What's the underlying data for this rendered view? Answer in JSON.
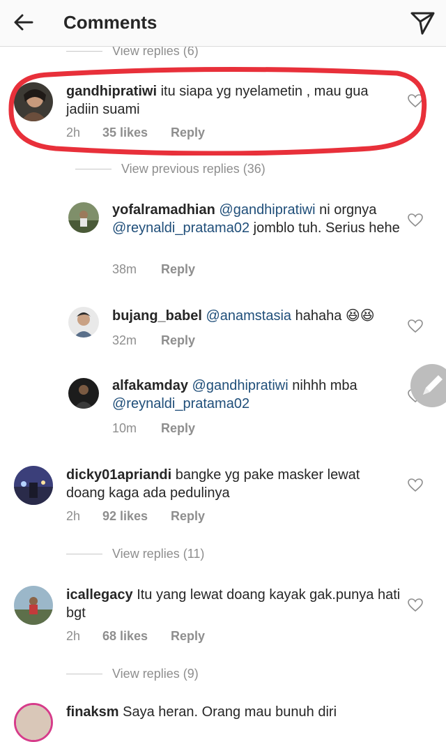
{
  "header": {
    "title": "Comments"
  },
  "top_view_replies": "View replies (6)",
  "comments": [
    {
      "username": "gandhipratiwi",
      "text": "itu siapa yg nyelametin , mau gua jadiin suami",
      "time": "2h",
      "likes": "35 likes",
      "reply": "Reply"
    },
    {
      "view_previous": "View previous replies (36)"
    },
    {
      "username": "yofalramadhian",
      "mention1": "@gandhipratiwi",
      "text1": "ni orgnya",
      "mention2": "@reynaldi_pratama02",
      "text2": "jomblo tuh. Serius hehe",
      "time": "38m",
      "reply": "Reply"
    },
    {
      "username": "bujang_babel",
      "mention1": "@anamstasia",
      "text1": "hahaha 😆😆",
      "time": "32m",
      "reply": "Reply"
    },
    {
      "username": "alfakamday",
      "mention1": "@gandhipratiwi",
      "text1": "nihhh mba",
      "mention2": "@reynaldi_pratama02",
      "time": "10m",
      "reply": "Reply"
    },
    {
      "username": "dicky01apriandi",
      "text": "bangke yg pake masker lewat doang kaga ada pedulinya",
      "time": "2h",
      "likes": "92 likes",
      "reply": "Reply",
      "view_replies": "View replies (11)"
    },
    {
      "username": "icallegacy",
      "text": "Itu yang lewat doang kayak gak.punya hati bgt",
      "time": "2h",
      "likes": "68 likes",
      "reply": "Reply",
      "view_replies": "View replies (9)"
    },
    {
      "username": "finaksm",
      "text": "Saya heran. Orang mau bunuh diri"
    }
  ],
  "colors": {
    "highlight": "#e8303a",
    "mention": "#1f4e79",
    "meta": "#8e8e8e"
  },
  "icons": [
    "back-arrow-icon",
    "send-icon",
    "heart-icon",
    "pencil-icon"
  ]
}
